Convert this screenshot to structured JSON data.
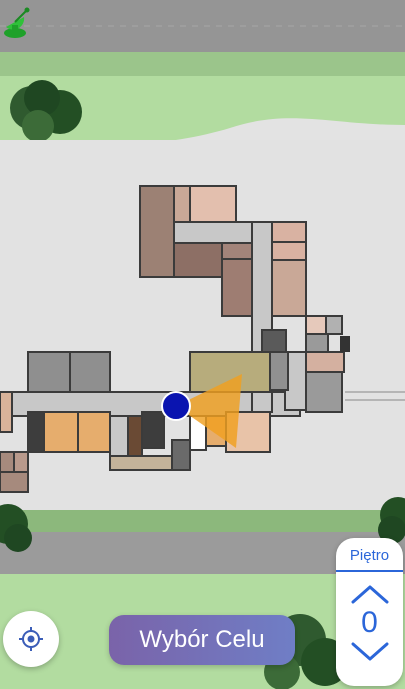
{
  "floor_selector": {
    "title": "Piętro",
    "current_floor": "0"
  },
  "target_button": {
    "label": "Wybór Celu"
  },
  "icons": {
    "app": "satellite-dish-icon",
    "locate": "crosshair-locate-icon",
    "up": "chevron-up-icon",
    "down": "chevron-down-icon"
  },
  "colors": {
    "accent": "#2b66d9",
    "user_marker": "#0a14b0",
    "heading_cone": "#f0a020",
    "lawn": "#a7d58e",
    "road": "#9a9a9a"
  }
}
